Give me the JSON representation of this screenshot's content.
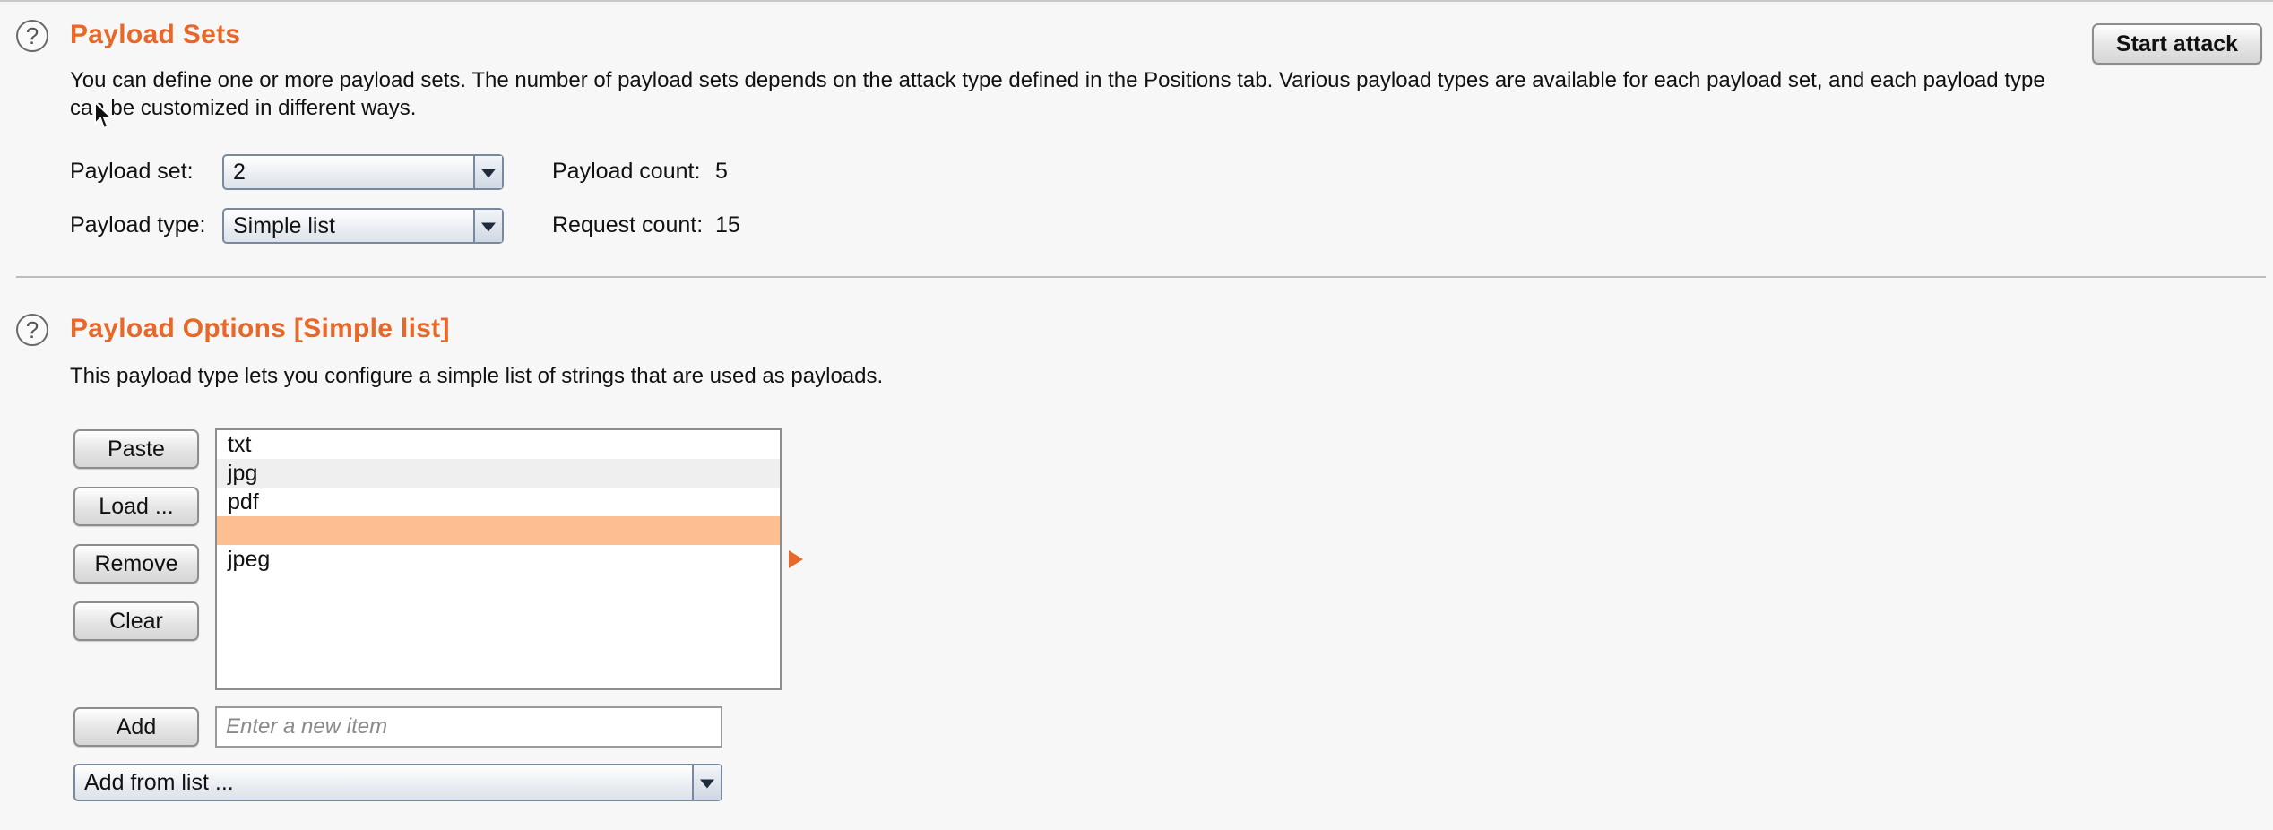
{
  "payload_sets": {
    "title": "Payload Sets",
    "description": "You can define one or more payload sets. The number of payload sets depends on the attack type defined in the Positions tab. Various payload types are available for each payload set, and each payload type can be customized in different ways.",
    "start_attack_label": "Start attack",
    "payload_set_label": "Payload set:",
    "payload_set_value": "2",
    "payload_type_label": "Payload type:",
    "payload_type_value": "Simple list",
    "payload_count_label": "Payload count:",
    "payload_count_value": "5",
    "request_count_label": "Request count:",
    "request_count_value": "15"
  },
  "payload_options": {
    "title": "Payload Options [Simple list]",
    "description": "This payload type lets you configure a simple list of strings that are used as payloads.",
    "buttons": {
      "paste": "Paste",
      "load": "Load ...",
      "remove": "Remove",
      "clear": "Clear",
      "add": "Add"
    },
    "list_items": [
      {
        "text": "txt"
      },
      {
        "text": "jpg"
      },
      {
        "text": "pdf"
      },
      {
        "text": ""
      },
      {
        "text": "jpeg"
      }
    ],
    "selected_index": 3,
    "new_item_placeholder": "Enter a new item",
    "add_from_list_value": "Add from list ..."
  },
  "help_icon_glyph": "?",
  "colors": {
    "accent": "#e8682a",
    "selection": "#fdbe92"
  }
}
